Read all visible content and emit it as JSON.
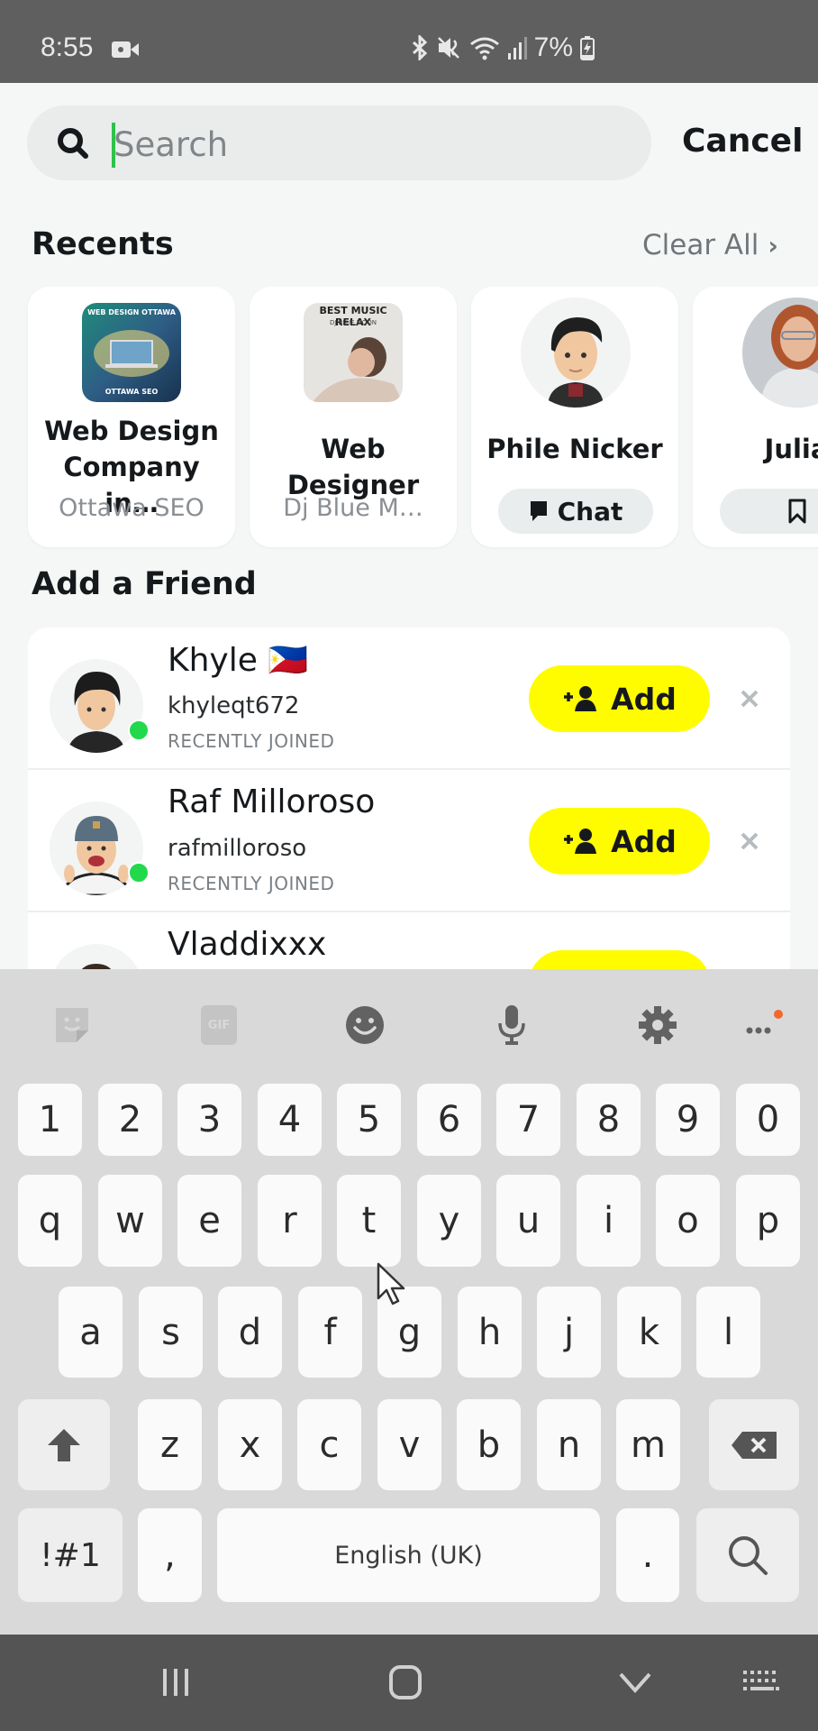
{
  "status_bar": {
    "time": "8:55",
    "battery_percent": "7%",
    "icons": [
      "screen-record-icon",
      "bluetooth-icon",
      "mute-icon",
      "wifi-icon",
      "signal-icon",
      "battery-charging-icon"
    ]
  },
  "search": {
    "placeholder": "Search",
    "value": "",
    "cancel_label": "Cancel"
  },
  "recents": {
    "title": "Recents",
    "clear_all_label": "Clear All",
    "items": [
      {
        "name_line1": "Web Design",
        "name_line2": "Company in…",
        "subtitle": "Ottawa SEO",
        "thumb_text_top": "WEB DESIGN OTTAWA",
        "thumb_text_bottom": "OTTAWA SEO"
      },
      {
        "name": "Web Designer",
        "subtitle": "Dj Blue M…",
        "thumb_text_top": "BEST MUSIC RELAX",
        "thumb_text_bottom": "DJ BLUE MOON"
      },
      {
        "name": "Phile Nicker",
        "action_label": "Chat",
        "action_icon": "chat-bubble-icon"
      },
      {
        "name": "Julia",
        "action_icon": "bookmark-icon"
      }
    ]
  },
  "add_friend": {
    "title": "Add a Friend",
    "add_label": "Add",
    "friends": [
      {
        "name": "Khyle 🇵🇭",
        "username": "khyleqt672",
        "tag": "RECENTLY JOINED",
        "online": true
      },
      {
        "name": "Raf Milloroso",
        "username": "rafmilloroso",
        "tag": "RECENTLY JOINED",
        "online": true
      },
      {
        "name": "Vladdixxx",
        "username": "",
        "tag": "",
        "online": false
      }
    ]
  },
  "keyboard": {
    "toolbar": [
      "sticker-icon",
      "gif-icon",
      "emoji-icon",
      "microphone-icon",
      "settings-icon",
      "more-icon"
    ],
    "gif_label": "GIF",
    "row_numbers": [
      "1",
      "2",
      "3",
      "4",
      "5",
      "6",
      "7",
      "8",
      "9",
      "0"
    ],
    "row_q": [
      "q",
      "w",
      "e",
      "r",
      "t",
      "y",
      "u",
      "i",
      "o",
      "p"
    ],
    "row_a": [
      "a",
      "s",
      "d",
      "f",
      "g",
      "h",
      "j",
      "k",
      "l"
    ],
    "row_z": [
      "z",
      "x",
      "c",
      "v",
      "b",
      "n",
      "m"
    ],
    "symbols_label": "!#1",
    "comma_label": ",",
    "space_label": "English (UK)",
    "period_label": "."
  },
  "nav_bar": {
    "buttons": [
      "recent-apps-icon",
      "home-icon",
      "hide-keyboard-icon",
      "keyboard-switch-icon"
    ]
  },
  "colors": {
    "accent_yellow": "#fffc00",
    "online_green": "#21d94a",
    "caret_green": "#2ec24a"
  }
}
